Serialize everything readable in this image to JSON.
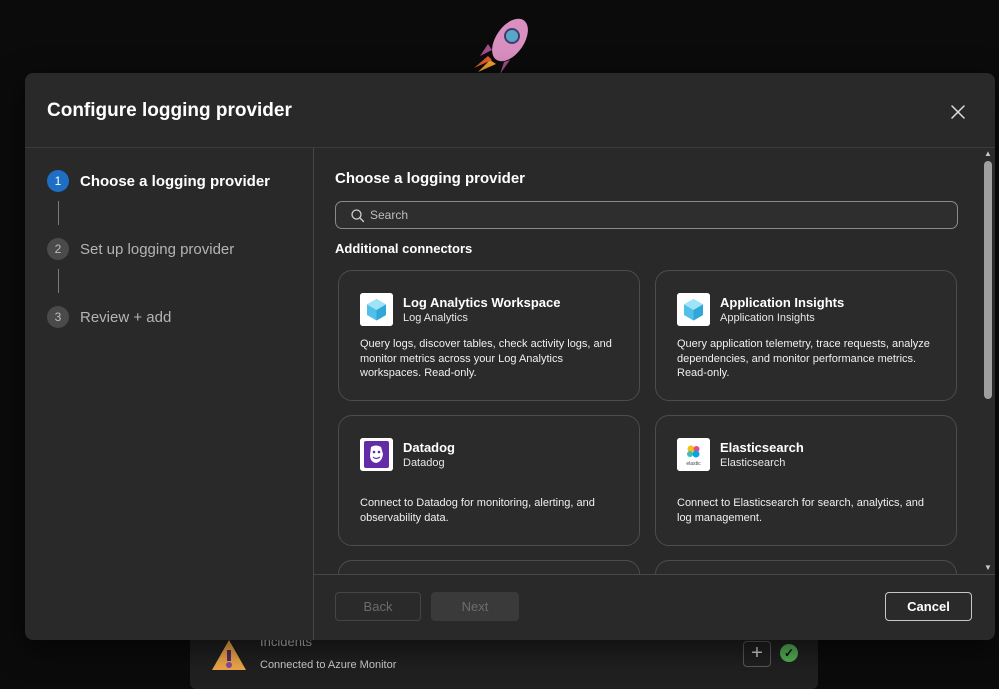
{
  "background": {
    "item_title": "Incidents",
    "item_subtitle": "Connected to Azure Monitor",
    "add_label": "+",
    "check_label": "✓"
  },
  "modal": {
    "title": "Configure logging provider",
    "close_icon": "close-icon"
  },
  "steps": [
    {
      "number": "1",
      "label": "Choose a logging provider",
      "state": "active"
    },
    {
      "number": "2",
      "label": "Set up logging provider",
      "state": "inactive"
    },
    {
      "number": "3",
      "label": "Review + add",
      "state": "inactive"
    }
  ],
  "content": {
    "title": "Choose a logging provider",
    "search": {
      "placeholder": "Search",
      "value": ""
    },
    "section_label": "Additional connectors",
    "connectors": [
      {
        "name": "Log Analytics Workspace",
        "subtitle": "Log Analytics",
        "description": "Query logs, discover tables, check activity logs, and monitor metrics across your Log Analytics workspaces. Read-only.",
        "icon": "log-analytics-icon"
      },
      {
        "name": "Application Insights",
        "subtitle": "Application Insights",
        "description": "Query application telemetry, trace requests, analyze dependencies, and monitor performance metrics. Read-only.",
        "icon": "application-insights-icon"
      },
      {
        "name": "Datadog",
        "subtitle": "Datadog",
        "description": "Connect to Datadog for monitoring, alerting, and observability data.",
        "icon": "datadog-icon"
      },
      {
        "name": "Elasticsearch",
        "subtitle": "Elasticsearch",
        "description": "Connect to Elasticsearch for search, analytics, and log management.",
        "icon": "elasticsearch-icon",
        "logo_text": "elastic"
      }
    ]
  },
  "footer": {
    "back_label": "Back",
    "next_label": "Next",
    "cancel_label": "Cancel"
  },
  "colors": {
    "accent": "#1e6fc4",
    "modal_bg": "#292929",
    "datadog_purple": "#632ca6",
    "status_green": "#54b054"
  }
}
